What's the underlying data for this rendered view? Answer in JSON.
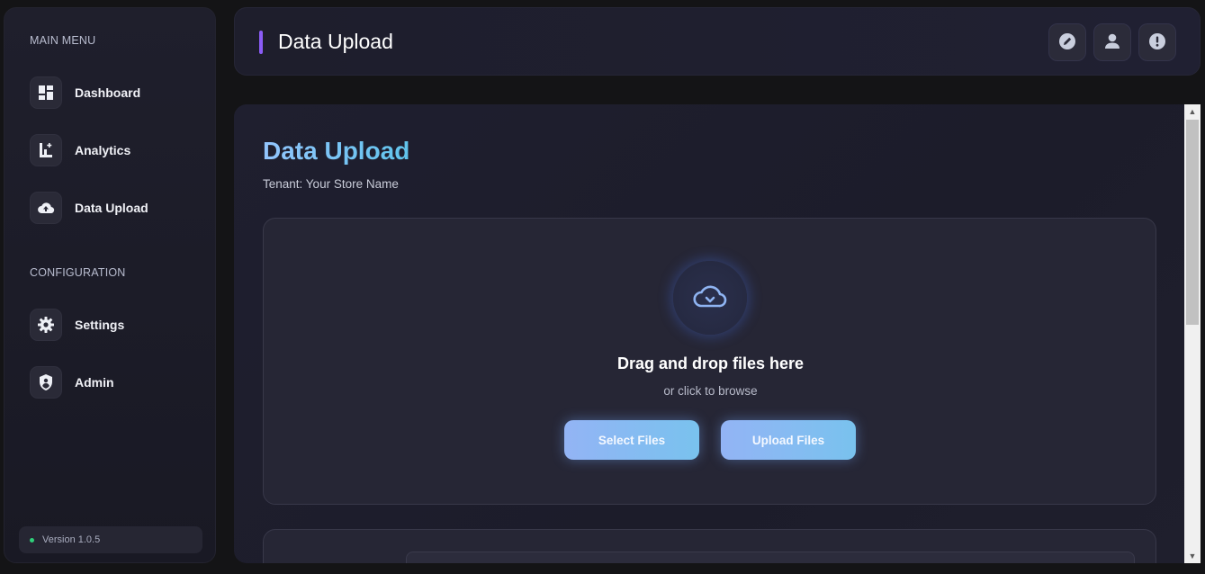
{
  "sidebar": {
    "main_menu_label": "MAIN MENU",
    "configuration_label": "CONFIGURATION",
    "items": [
      {
        "label": "Dashboard",
        "icon": "dashboard-icon"
      },
      {
        "label": "Analytics",
        "icon": "analytics-icon"
      },
      {
        "label": "Data Upload",
        "icon": "cloud-upload-icon"
      },
      {
        "label": "Settings",
        "icon": "gear-icon"
      },
      {
        "label": "Admin",
        "icon": "shield-icon"
      }
    ],
    "version": "Version 1.0.5"
  },
  "header": {
    "title": "Data Upload",
    "actions": [
      {
        "icon": "edit-icon"
      },
      {
        "icon": "user-icon"
      },
      {
        "icon": "alert-icon"
      }
    ]
  },
  "main": {
    "title": "Data Upload",
    "tenant": "Tenant: Your Store Name",
    "dropzone": {
      "title": "Drag and drop files here",
      "subtitle": "or click to browse",
      "select_label": "Select Files",
      "upload_label": "Upload Files"
    }
  },
  "colors": {
    "accent": "#8b5cf6",
    "status_dot": "#2fd07a",
    "button_gradient_start": "#93b4f5",
    "button_gradient_end": "#79c2ee"
  }
}
